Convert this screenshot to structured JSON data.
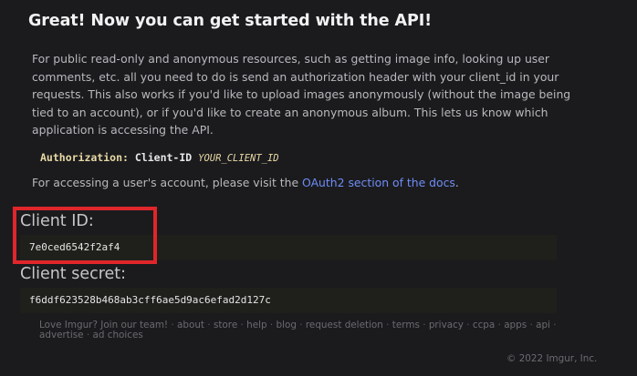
{
  "heading": "Great! Now you can get started with the API!",
  "intro": "For public read-only and anonymous resources, such as getting image info, looking up user comments, etc. all you need to do is send an authorization header with your client_id in your requests. This also works if you'd like to upload images anonymously (without the image being tied to an account), or if you'd like to create an anonymous album. This lets us know which application is accessing the API.",
  "auth_example": {
    "key": "Authorization:",
    "value": "Client-ID",
    "placeholder": "YOUR_CLIENT_ID"
  },
  "oauth": {
    "prefix": "For accessing a user's account, please visit the ",
    "link_text": "OAuth2 section of the docs",
    "suffix": "."
  },
  "client_id": {
    "label": "Client ID:",
    "value": "7e0ced6542f2af4"
  },
  "client_secret": {
    "label": "Client secret:",
    "value": "f6ddf623528b468ab3cff6ae5d9ac6efad2d127c"
  },
  "footer": {
    "links": [
      "Love Imgur? Join our team!",
      "about",
      "store",
      "help",
      "blog",
      "request deletion",
      "terms",
      "privacy",
      "ccpa",
      "apps",
      "api",
      "advertise",
      "ad choices"
    ],
    "separator": "·",
    "copyright": "© 2022 Imgur, Inc."
  },
  "colors": {
    "background": "#1b1b1e",
    "link": "#6f8df5",
    "highlight": "#e0262a",
    "code": "#e8d9a4"
  }
}
